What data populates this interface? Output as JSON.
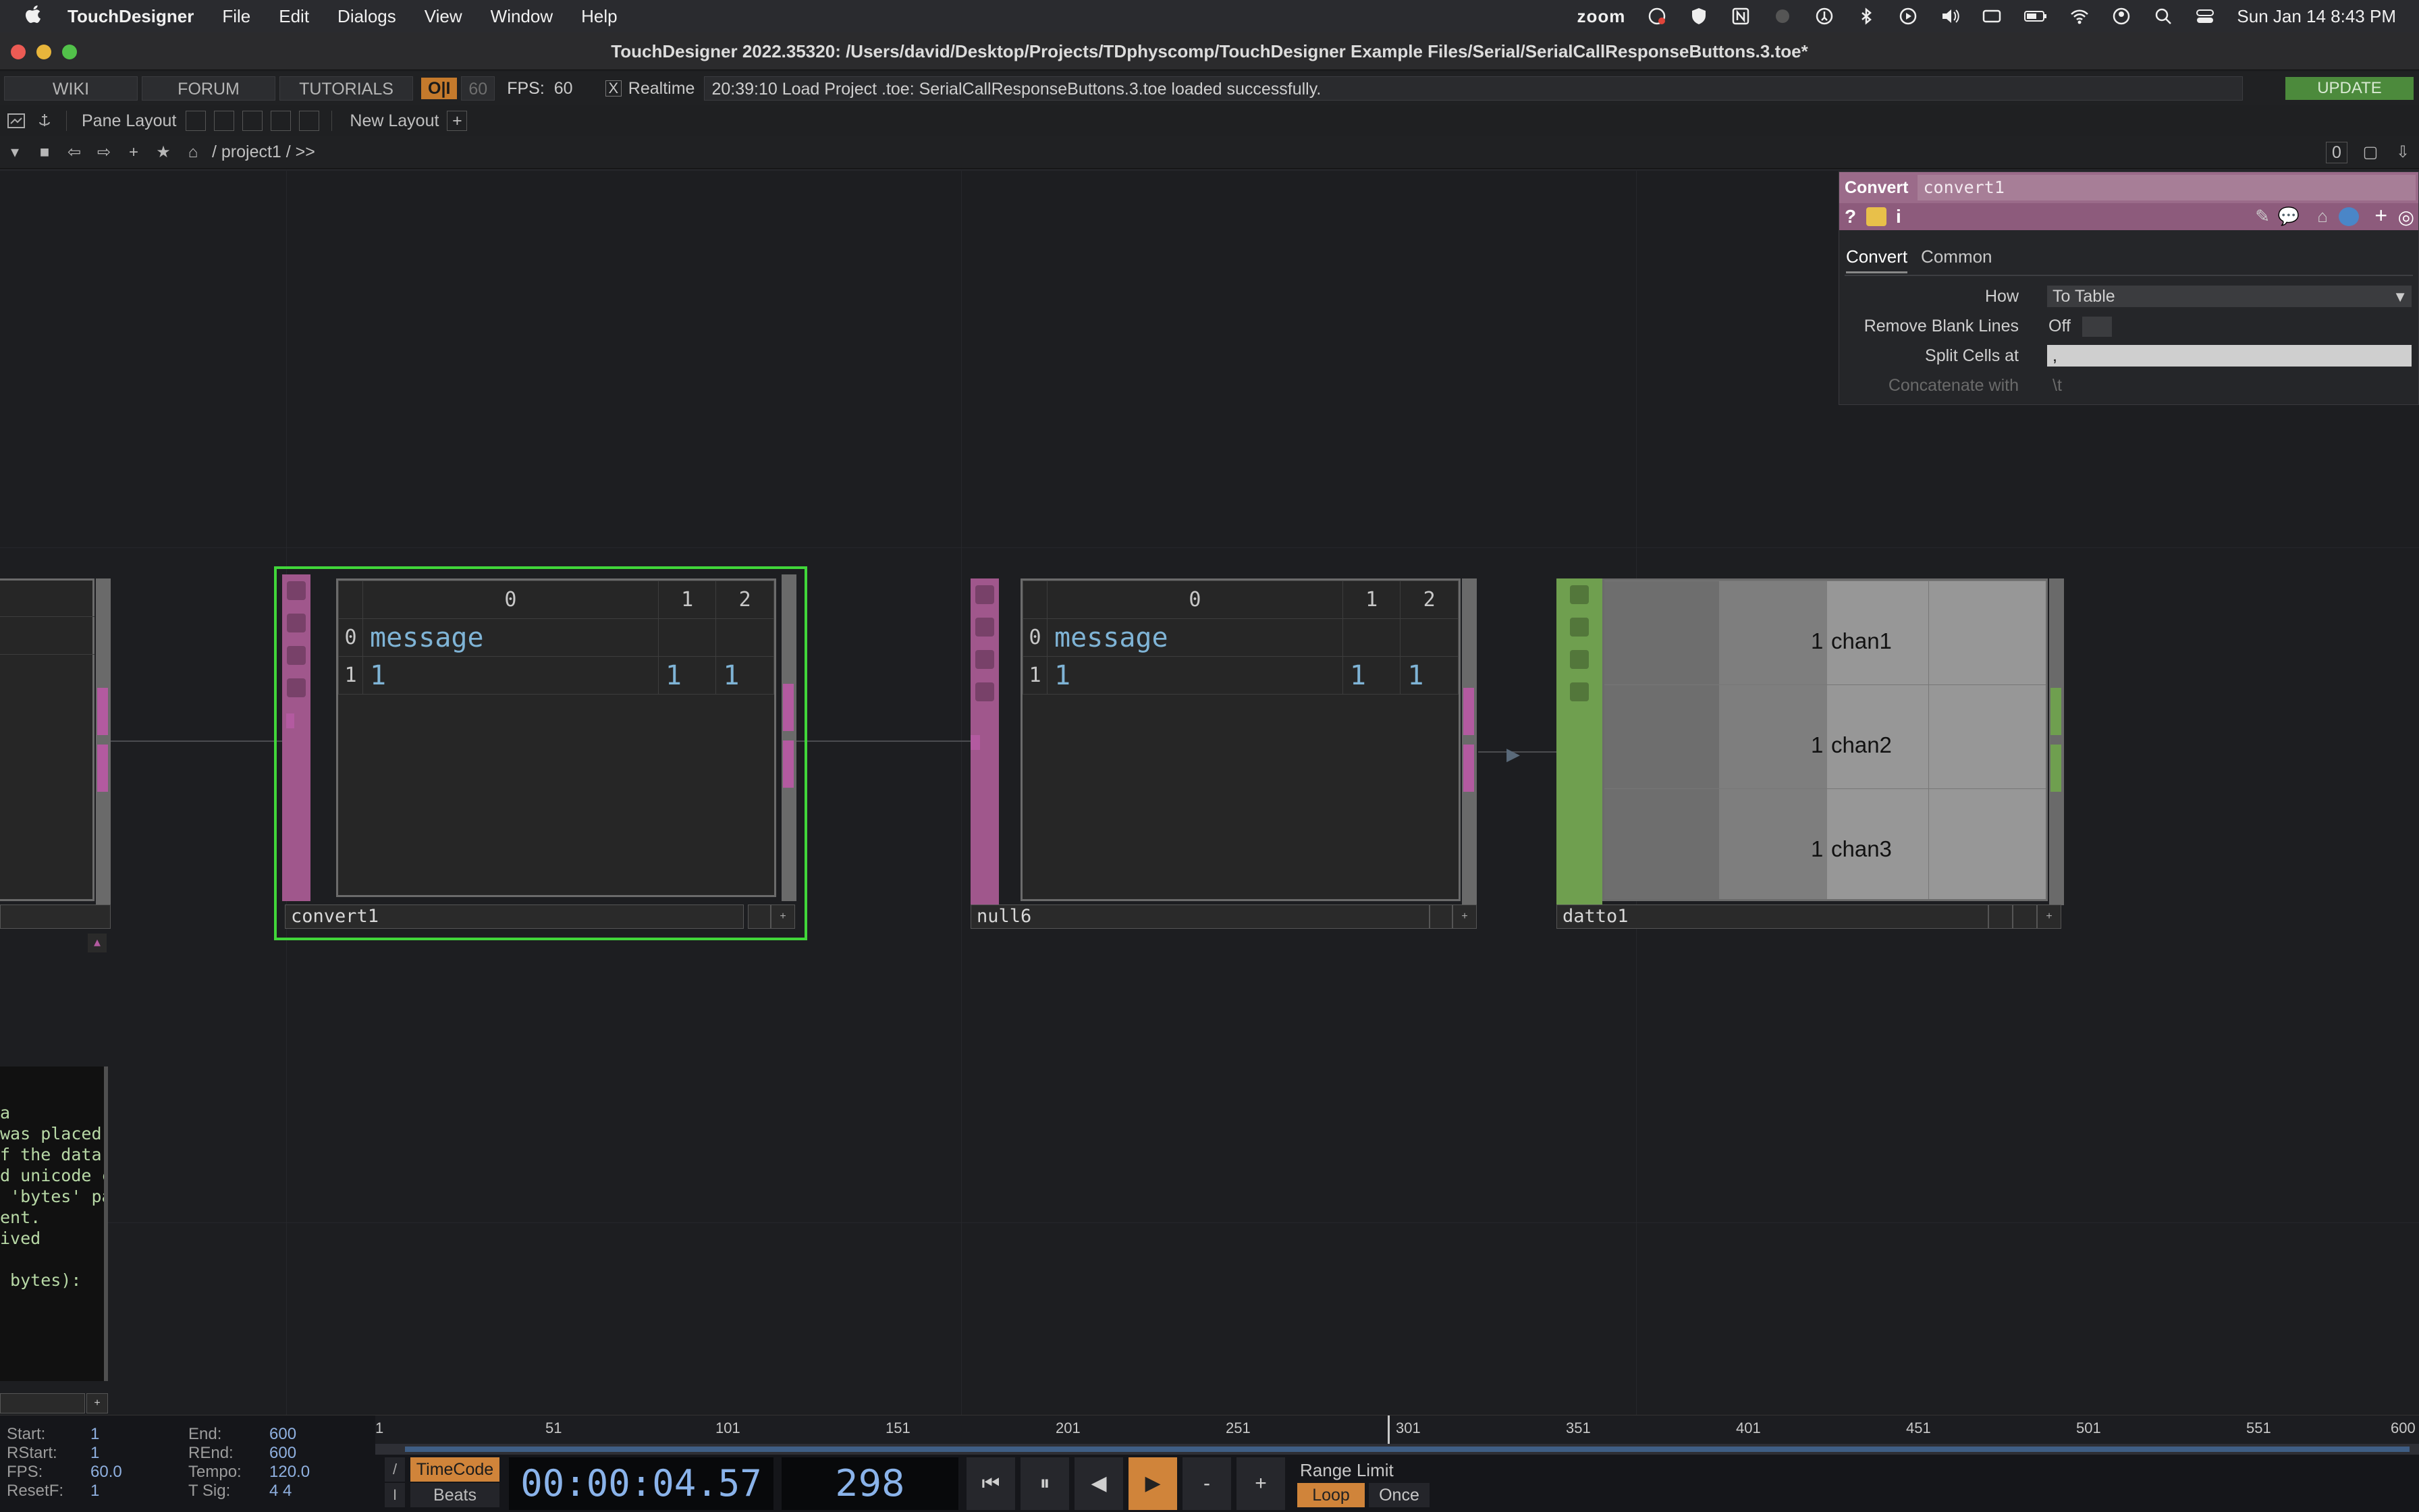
{
  "menubar": {
    "app": "TouchDesigner",
    "items": [
      "File",
      "Edit",
      "Dialogs",
      "View",
      "Window",
      "Help"
    ],
    "zoom": "zoom",
    "clock": "Sun Jan 14  8:43 PM"
  },
  "window": {
    "title": "TouchDesigner 2022.35320: /Users/david/Desktop/Projects/TDphyscomp/TouchDesigner Example Files/Serial/SerialCallResponseButtons.3.toe*"
  },
  "toolbar": {
    "wiki": "WIKI",
    "forum": "FORUM",
    "tutorials": "TUTORIALS",
    "oi": "O|I",
    "fps_value_box": "60",
    "fps_label": "FPS:",
    "fps_value": "60",
    "realtime_check": "X",
    "realtime_label": "Realtime",
    "message": "20:39:10 Load Project .toe: SerialCallResponseButtons.3.toe loaded successfully.",
    "update": "UPDATE"
  },
  "layoutbar": {
    "pane_layout": "Pane Layout",
    "new_layout": "New Layout",
    "plus": "+"
  },
  "pathbar": {
    "path": "/ project1 / >>",
    "counter": "0"
  },
  "nodes": {
    "convert1": {
      "name": "convert1",
      "headers": [
        "0",
        "1",
        "2"
      ],
      "rows": [
        {
          "index": "0",
          "cells": [
            "message",
            "",
            ""
          ]
        },
        {
          "index": "1",
          "cells": [
            "1",
            "1",
            "1"
          ]
        }
      ]
    },
    "null6": {
      "name": "null6",
      "headers": [
        "0",
        "1",
        "2"
      ],
      "rows": [
        {
          "index": "0",
          "cells": [
            "message",
            "",
            ""
          ]
        },
        {
          "index": "1",
          "cells": [
            "1",
            "1",
            "1"
          ]
        }
      ]
    },
    "datto1": {
      "name": "datto1",
      "rows": [
        {
          "value": "1",
          "chan": "chan1"
        },
        {
          "value": "1",
          "chan": "chan2"
        },
        {
          "value": "1",
          "chan": "chan3"
        }
      ]
    }
  },
  "params": {
    "op_type": "Convert",
    "op_name": "convert1",
    "tabs": [
      "Convert",
      "Common"
    ],
    "rows": [
      {
        "label": "How",
        "value": "To Table"
      },
      {
        "label": "Remove Blank Lines",
        "value": "Off"
      },
      {
        "label": "Split Cells at",
        "value": ","
      },
      {
        "label": "Concatenate with",
        "value": "\\t"
      }
    ]
  },
  "textport": {
    "lines": [
      "a",
      "was placed",
      "f the data",
      "d unicode c",
      " 'bytes' pa",
      "ent.",
      "ived",
      "",
      " bytes):"
    ]
  },
  "timeline": {
    "ticks": [
      "1",
      "51",
      "101",
      "151",
      "201",
      "251",
      "301",
      "351",
      "401",
      "451",
      "501",
      "551",
      "600"
    ],
    "stats": [
      {
        "k": "Start:",
        "v": "1",
        "k2": "End:",
        "v2": "600"
      },
      {
        "k": "RStart:",
        "v": "1",
        "k2": "REnd:",
        "v2": "600"
      },
      {
        "k": "FPS:",
        "v": "60.0",
        "k2": "Tempo:",
        "v2": "120.0"
      },
      {
        "k": "ResetF:",
        "v": "1",
        "k2": "T Sig:",
        "v2": "4      4"
      }
    ],
    "timecode": "TimeCode",
    "beats": "Beats",
    "clock": "00:00:04.57",
    "frame": "298",
    "range_limit": "Range Limit",
    "loop": "Loop",
    "once": "Once",
    "minus": "-",
    "plus": "+"
  },
  "colors": {
    "dat_purple": "#b35aa0",
    "chop_green": "#6f9f4f",
    "selection": "#41d63a",
    "accent_orange": "#d0843a"
  }
}
